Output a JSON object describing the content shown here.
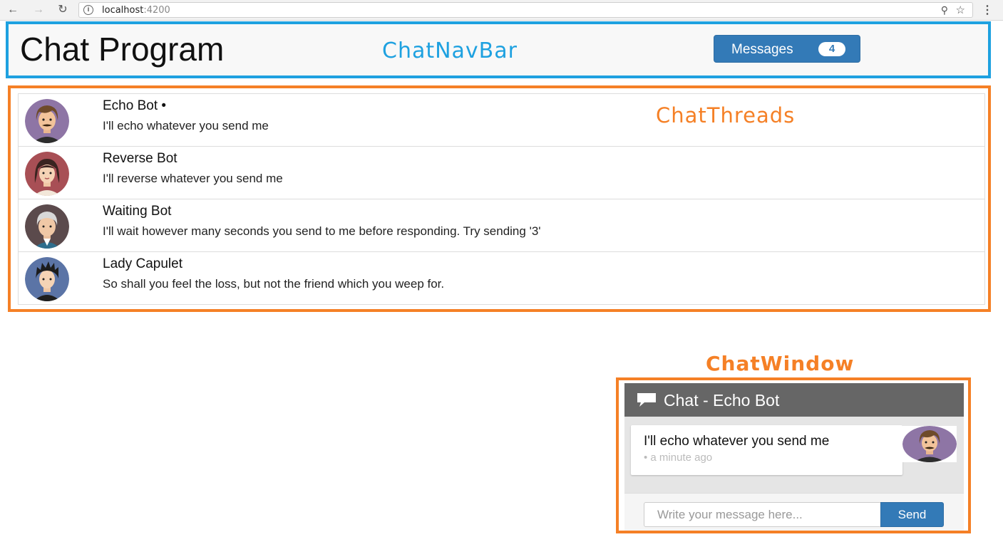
{
  "browser": {
    "url_host": "localhost",
    "url_port": ":4200",
    "icons": {
      "back": "arrow-left-icon",
      "forward": "arrow-right-icon",
      "reload": "reload-icon",
      "info": "info-icon",
      "zoom": "zoom-icon",
      "bookmark": "star-icon",
      "menu": "kebab-menu-icon"
    }
  },
  "navbar": {
    "brand": "Chat Program",
    "annotation": "ChatNavBar",
    "messages_label": "Messages",
    "messages_count": "4"
  },
  "threads": {
    "annotation": "ChatThreads",
    "items": [
      {
        "name": "Echo Bot •",
        "message": "I'll echo whatever you send me",
        "avatar": "avatar-echo-bot"
      },
      {
        "name": "Reverse Bot",
        "message": "I'll reverse whatever you send me",
        "avatar": "avatar-reverse-bot"
      },
      {
        "name": "Waiting Bot",
        "message": "I'll wait however many seconds you send to me before responding. Try sending '3'",
        "avatar": "avatar-waiting-bot"
      },
      {
        "name": "Lady Capulet",
        "message": "So shall you feel the loss, but not the friend which you weep for.",
        "avatar": "avatar-lady-capulet"
      }
    ]
  },
  "chat_window": {
    "annotation": "ChatWindow",
    "title": "Chat - Echo Bot",
    "messages": [
      {
        "text": "I'll echo whatever you send me",
        "time": "• a minute ago"
      }
    ],
    "input_placeholder": "Write your message here...",
    "send_label": "Send"
  },
  "colors": {
    "navbar_outline": "#1ea1e0",
    "annotation_orange": "#f58026",
    "primary_button": "#337ab7",
    "chat_header": "#666666"
  }
}
